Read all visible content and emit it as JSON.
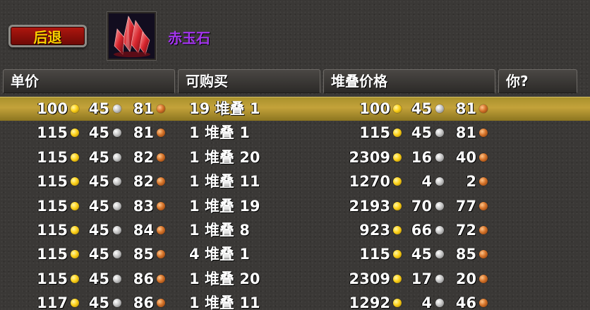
{
  "toolbar": {
    "back_label": "后退"
  },
  "item": {
    "name": "赤玉石",
    "icon": "red-crystal-icon",
    "name_color": "#a335ee"
  },
  "columns": {
    "unit_price": "单价",
    "available": "可购买",
    "stack_price": "堆叠价格",
    "you": "你?"
  },
  "selected_row": 0,
  "colors": {
    "selected_row": "#c3a23a",
    "button": "#b0170f",
    "button_text": "#ffd100"
  },
  "rows": [
    {
      "unit": {
        "gold": "100",
        "silver": "45",
        "copper": "81"
      },
      "available": "19 堆叠 1",
      "stack": {
        "gold": "100",
        "silver": "45",
        "copper": "81"
      }
    },
    {
      "unit": {
        "gold": "115",
        "silver": "45",
        "copper": "81"
      },
      "available": "1 堆叠 1",
      "stack": {
        "gold": "115",
        "silver": "45",
        "copper": "81"
      }
    },
    {
      "unit": {
        "gold": "115",
        "silver": "45",
        "copper": "82"
      },
      "available": "1 堆叠 20",
      "stack": {
        "gold": "2309",
        "silver": "16",
        "copper": "40"
      }
    },
    {
      "unit": {
        "gold": "115",
        "silver": "45",
        "copper": "82"
      },
      "available": "1 堆叠 11",
      "stack": {
        "gold": "1270",
        "silver": "4",
        "copper": "2"
      }
    },
    {
      "unit": {
        "gold": "115",
        "silver": "45",
        "copper": "83"
      },
      "available": "1 堆叠 19",
      "stack": {
        "gold": "2193",
        "silver": "70",
        "copper": "77"
      }
    },
    {
      "unit": {
        "gold": "115",
        "silver": "45",
        "copper": "84"
      },
      "available": "1 堆叠 8",
      "stack": {
        "gold": "923",
        "silver": "66",
        "copper": "72"
      }
    },
    {
      "unit": {
        "gold": "115",
        "silver": "45",
        "copper": "85"
      },
      "available": "4 堆叠 1",
      "stack": {
        "gold": "115",
        "silver": "45",
        "copper": "85"
      }
    },
    {
      "unit": {
        "gold": "115",
        "silver": "45",
        "copper": "86"
      },
      "available": "1 堆叠 20",
      "stack": {
        "gold": "2309",
        "silver": "17",
        "copper": "20"
      }
    },
    {
      "unit": {
        "gold": "117",
        "silver": "45",
        "copper": "86"
      },
      "available": "1 堆叠 11",
      "stack": {
        "gold": "1292",
        "silver": "4",
        "copper": "46"
      }
    }
  ]
}
